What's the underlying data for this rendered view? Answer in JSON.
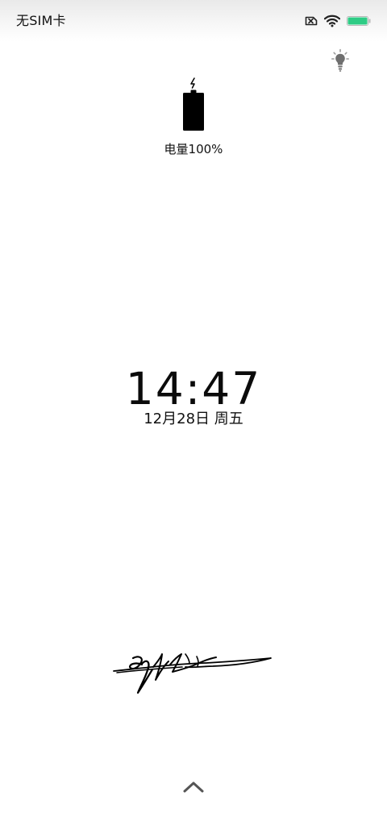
{
  "status_bar": {
    "carrier": "无SIM卡",
    "sim_icon": "no-sim-icon",
    "wifi_icon": "wifi-icon",
    "battery_icon": "battery-icon",
    "battery_level_percent": 100,
    "battery_color": "#2ecc85"
  },
  "lock_screen": {
    "flashlight_icon": "flashlight-icon",
    "charging_icon": "charging-battery-icon",
    "battery_text": "电量100%",
    "time": "14:47",
    "date": "12月28日 周五",
    "signature": "handwritten-signature",
    "unlock_icon": "chevron-up-icon"
  }
}
